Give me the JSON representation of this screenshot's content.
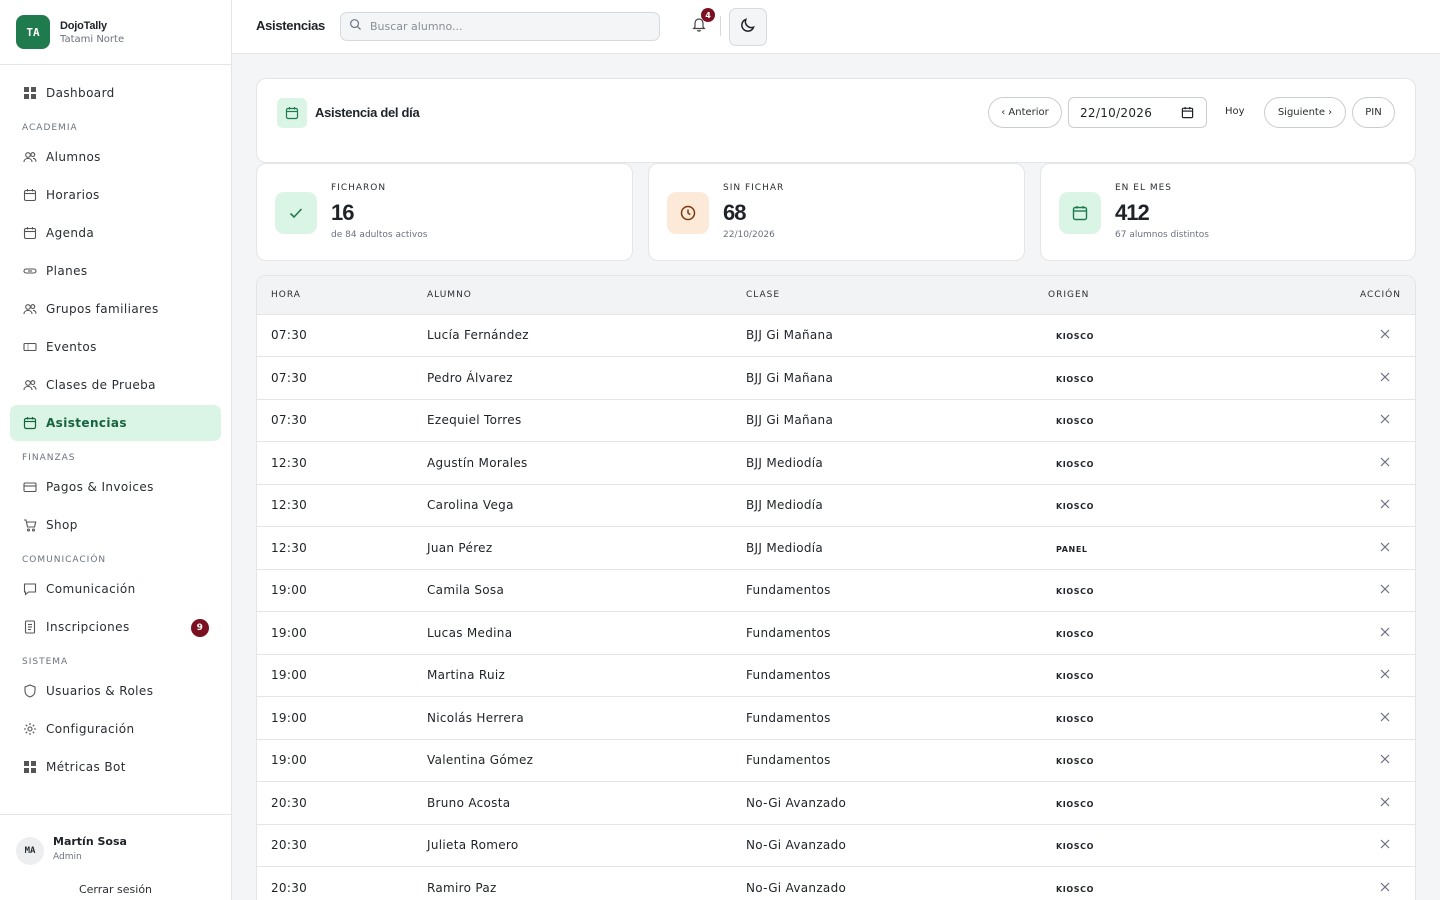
{
  "brand": {
    "initials": "TA",
    "name": "DojoTally",
    "subtitle": "Tatami Norte"
  },
  "sidebar": {
    "dashboard": "Dashboard",
    "section_academia": "ACADEMIA",
    "alumnos": "Alumnos",
    "horarios": "Horarios",
    "agenda": "Agenda",
    "planes": "Planes",
    "grupos": "Grupos familiares",
    "eventos": "Eventos",
    "clases_prueba": "Clases de Prueba",
    "asistencias": "Asistencias",
    "section_finanzas": "FINANZAS",
    "pagos": "Pagos & Invoices",
    "shop": "Shop",
    "section_comunicacion": "COMUNICACIÓN",
    "comunicacion": "Comunicación",
    "inscripciones": "Inscripciones",
    "inscripciones_badge": "9",
    "section_sistema": "SISTEMA",
    "usuarios": "Usuarios & Roles",
    "configuracion": "Configuración",
    "metricas": "Métricas Bot"
  },
  "user": {
    "initials": "MA",
    "name": "Martín Sosa",
    "role": "Admin",
    "logout": "Cerrar sesión"
  },
  "header": {
    "title": "Asistencias",
    "search_placeholder": "Buscar alumno...",
    "notifications_count": "4"
  },
  "attendance": {
    "title": "Asistencia del día",
    "prev": "‹ Anterior",
    "date": "22/10/2026",
    "today": "Hoy",
    "next": "Siguiente ›",
    "pin": "PIN"
  },
  "stats": {
    "ficharon": {
      "label": "FICHARON",
      "value": "16",
      "sub": "de 84 adultos activos"
    },
    "sin_fichar": {
      "label": "SIN FICHAR",
      "value": "68",
      "sub": "22/10/2026"
    },
    "mes": {
      "label": "EN EL MES",
      "value": "412",
      "sub": "67 alumnos distintos"
    }
  },
  "colors": {
    "accent": "#1f7a4d",
    "accent_soft": "#daf5e6",
    "warn_soft": "#fde9d7",
    "badge": "#7a1022"
  },
  "table": {
    "headers": {
      "hora": "HORA",
      "alumno": "ALUMNO",
      "clase": "CLASE",
      "origen": "ORIGEN",
      "accion": "ACCIÓN"
    },
    "rows": [
      {
        "hora": "07:30",
        "alumno": "Lucía Fernández",
        "clase": "BJJ Gi Mañana",
        "origen": "KIOSCO"
      },
      {
        "hora": "07:30",
        "alumno": "Pedro Álvarez",
        "clase": "BJJ Gi Mañana",
        "origen": "KIOSCO"
      },
      {
        "hora": "07:30",
        "alumno": "Ezequiel Torres",
        "clase": "BJJ Gi Mañana",
        "origen": "KIOSCO"
      },
      {
        "hora": "12:30",
        "alumno": "Agustín Morales",
        "clase": "BJJ Mediodía",
        "origen": "KIOSCO"
      },
      {
        "hora": "12:30",
        "alumno": "Carolina Vega",
        "clase": "BJJ Mediodía",
        "origen": "KIOSCO"
      },
      {
        "hora": "12:30",
        "alumno": "Juan Pérez",
        "clase": "BJJ Mediodía",
        "origen": "PANEL"
      },
      {
        "hora": "19:00",
        "alumno": "Camila Sosa",
        "clase": "Fundamentos",
        "origen": "KIOSCO"
      },
      {
        "hora": "19:00",
        "alumno": "Lucas Medina",
        "clase": "Fundamentos",
        "origen": "KIOSCO"
      },
      {
        "hora": "19:00",
        "alumno": "Martina Ruiz",
        "clase": "Fundamentos",
        "origen": "KIOSCO"
      },
      {
        "hora": "19:00",
        "alumno": "Nicolás Herrera",
        "clase": "Fundamentos",
        "origen": "KIOSCO"
      },
      {
        "hora": "19:00",
        "alumno": "Valentina Gómez",
        "clase": "Fundamentos",
        "origen": "KIOSCO"
      },
      {
        "hora": "20:30",
        "alumno": "Bruno Acosta",
        "clase": "No-Gi Avanzado",
        "origen": "KIOSCO"
      },
      {
        "hora": "20:30",
        "alumno": "Julieta Romero",
        "clase": "No-Gi Avanzado",
        "origen": "KIOSCO"
      },
      {
        "hora": "20:30",
        "alumno": "Ramiro Paz",
        "clase": "No-Gi Avanzado",
        "origen": "KIOSCO"
      }
    ]
  }
}
